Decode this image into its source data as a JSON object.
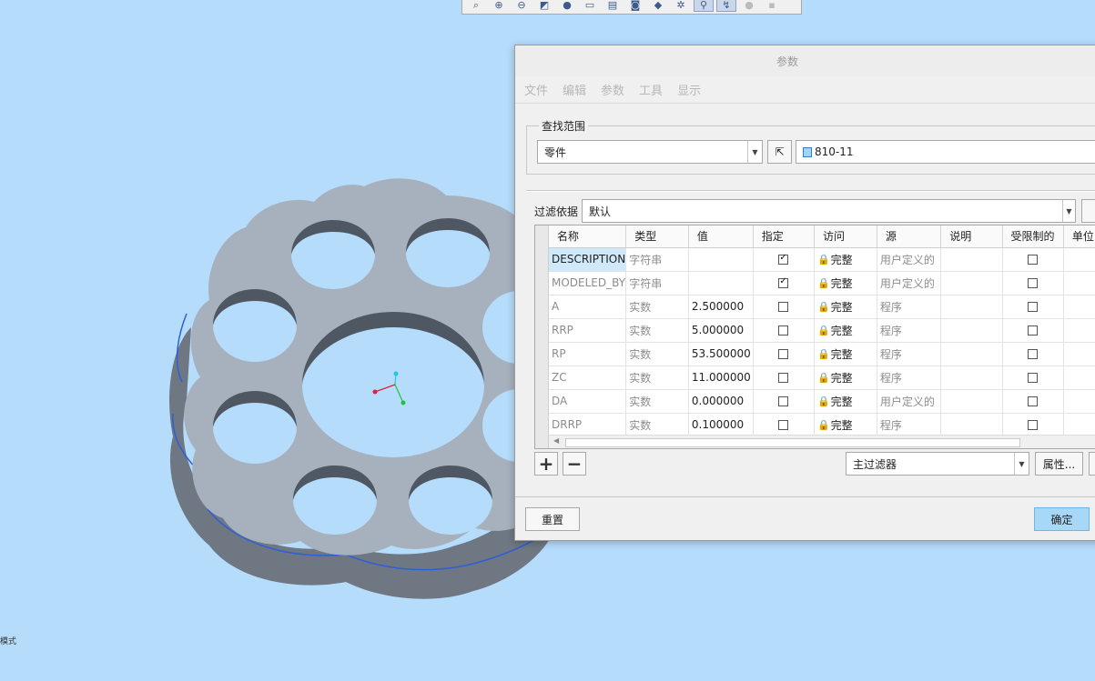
{
  "status_text": "模式",
  "toolbar": {
    "icons": [
      "zoom-fit-icon",
      "zoom-in-icon",
      "zoom-out-icon",
      "view-orient-icon",
      "shading-icon",
      "saved-views-icon",
      "layers-icon",
      "camera-icon",
      "view-3d-icon",
      "datum-display-icon",
      "spin-center-icon",
      "annotation-icon",
      "hidden-icon",
      "disabled-icon"
    ]
  },
  "dialog": {
    "title": "参数",
    "menu": [
      "文件",
      "编辑",
      "参数",
      "工具",
      "显示"
    ],
    "lookin": {
      "label": "查找范围",
      "scope_value": "零件",
      "model_name": "810-11"
    },
    "filter": {
      "label": "过滤依据",
      "value": "默认"
    },
    "table": {
      "columns": [
        "名称",
        "类型",
        "值",
        "指定",
        "访问",
        "源",
        "说明",
        "受限制的",
        "单位"
      ],
      "rows": [
        {
          "name": "DESCRIPTION",
          "type": "字符串",
          "value": "",
          "designated": true,
          "access": "完整",
          "source": "用户定义的",
          "desc": "",
          "restricted": false
        },
        {
          "name": "MODELED_BY",
          "type": "字符串",
          "value": "",
          "designated": true,
          "access": "完整",
          "source": "用户定义的",
          "desc": "",
          "restricted": false
        },
        {
          "name": "A",
          "type": "实数",
          "value": "2.500000",
          "designated": false,
          "access": "完整",
          "source": "程序",
          "desc": "",
          "restricted": false
        },
        {
          "name": "RRP",
          "type": "实数",
          "value": "5.000000",
          "designated": false,
          "access": "完整",
          "source": "程序",
          "desc": "",
          "restricted": false
        },
        {
          "name": "RP",
          "type": "实数",
          "value": "53.500000",
          "designated": false,
          "access": "完整",
          "source": "程序",
          "desc": "",
          "restricted": false
        },
        {
          "name": "ZC",
          "type": "实数",
          "value": "11.000000",
          "designated": false,
          "access": "完整",
          "source": "程序",
          "desc": "",
          "restricted": false
        },
        {
          "name": "DA",
          "type": "实数",
          "value": "0.000000",
          "designated": false,
          "access": "完整",
          "source": "用户定义的",
          "desc": "",
          "restricted": false
        },
        {
          "name": "DRRP",
          "type": "实数",
          "value": "0.100000",
          "designated": false,
          "access": "完整",
          "source": "程序",
          "desc": "",
          "restricted": false
        }
      ]
    },
    "add_label": "+",
    "remove_label": "−",
    "main_filter": "主过滤器",
    "properties_label": "属性...",
    "reset_label": "重置",
    "ok_label": "确定"
  }
}
